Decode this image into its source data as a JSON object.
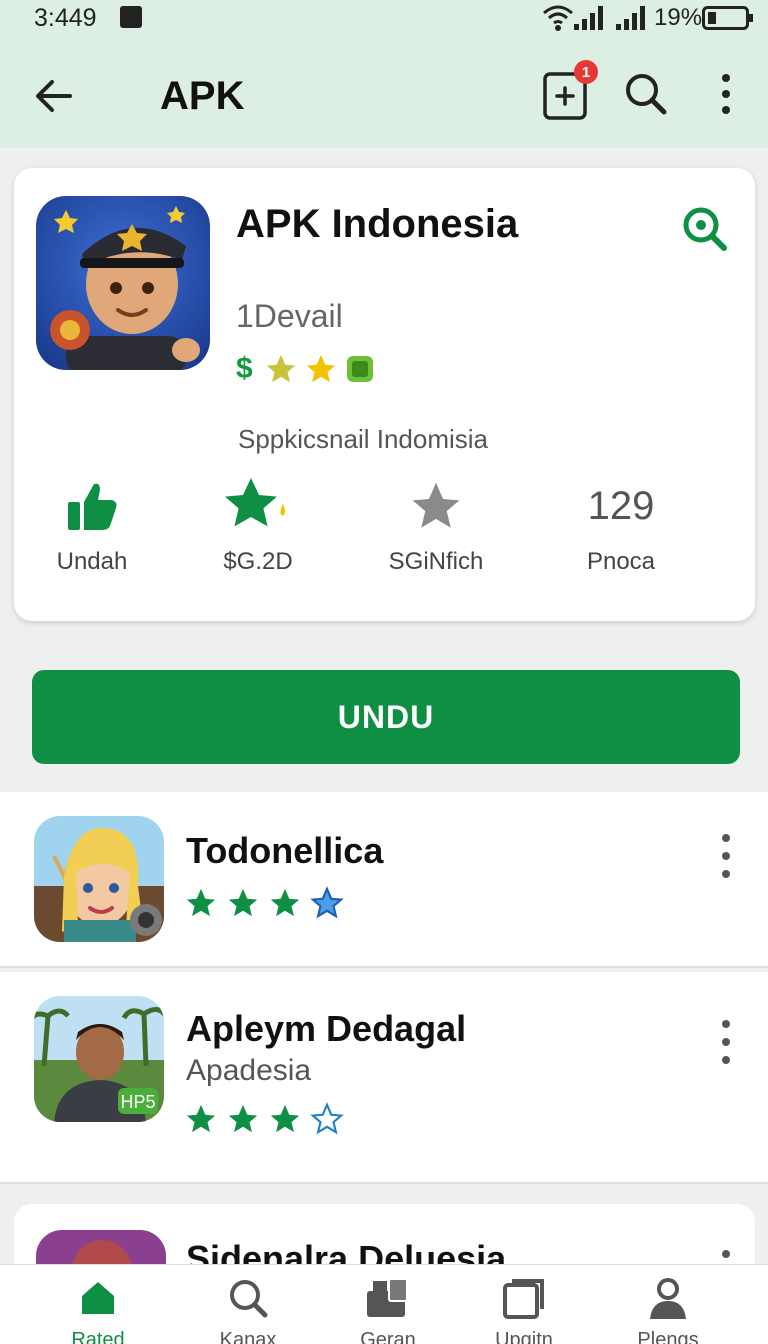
{
  "status_bar": {
    "time": "3:449",
    "battery": "19%"
  },
  "app_bar": {
    "title": "APK",
    "notification_count": "1"
  },
  "card": {
    "title": "APK Indonesia",
    "subtitle": "1Devail",
    "currency_symbol": "$",
    "caption": "Sppkicsnail  Indomisia",
    "stats": [
      {
        "label": "Undah",
        "icon": "thumbs-up-icon"
      },
      {
        "label": "$G.2D",
        "icon": "star-icon"
      },
      {
        "label": "SGiNfich",
        "icon": "star-outline-icon"
      },
      {
        "value": "129",
        "label": "Pnoca"
      }
    ]
  },
  "install_button": {
    "label": "UNDU"
  },
  "list": [
    {
      "name": "Todonellica",
      "subtitle": "",
      "rating": 3.5
    },
    {
      "name": "Apleym Dedagal",
      "subtitle": "Apadesia",
      "rating": 3,
      "badge": "HP5"
    },
    {
      "name": "Sidenalra Deluesia",
      "subtitle": ""
    }
  ],
  "bottom_nav": [
    {
      "label": "Rated",
      "icon": "home-icon",
      "active": true
    },
    {
      "label": "Kanax",
      "icon": "search-icon"
    },
    {
      "label": "Geran",
      "icon": "apps-icon"
    },
    {
      "label": "Upgitn",
      "icon": "window-icon"
    },
    {
      "label": "Plengs",
      "icon": "person-icon"
    }
  ],
  "colors": {
    "accent": "#0e8f43",
    "app_bar_bg": "#dcefe2",
    "badge": "#e53935"
  }
}
